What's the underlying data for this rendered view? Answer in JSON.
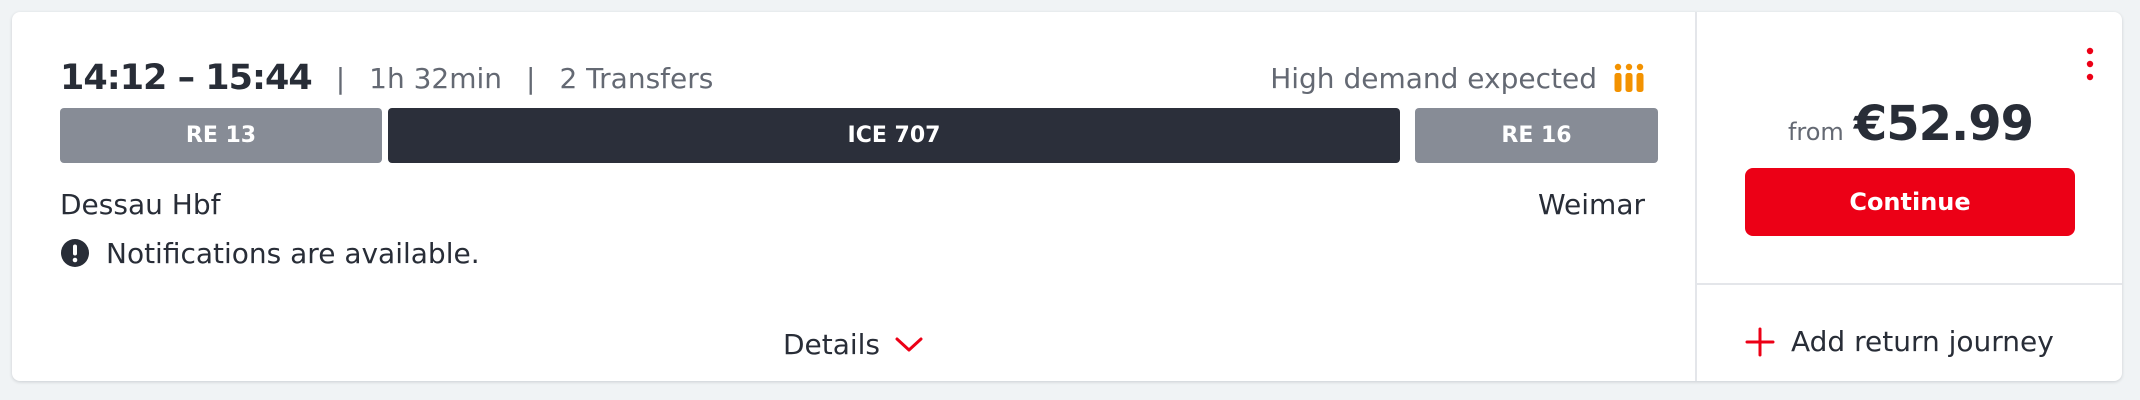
{
  "journey": {
    "time_range": "14:12 – 15:44",
    "separator": "|",
    "duration": "1h 32min",
    "transfers": "2 Transfers",
    "demand": {
      "label": "High demand expected",
      "icon": "occupancy-icon",
      "color": "#f39200"
    },
    "segments": [
      {
        "label": "RE 13",
        "kind": "regional"
      },
      {
        "label": "ICE 707",
        "kind": "long-distance"
      },
      {
        "label": "RE 16",
        "kind": "regional"
      }
    ],
    "origin": "Dessau Hbf",
    "destination": "Weimar",
    "notice": {
      "icon": "exclamation-circle-icon",
      "text": "Notifications are available."
    },
    "details": {
      "label": "Details",
      "icon": "chevron-down-icon"
    }
  },
  "offer": {
    "menu_icon": "kebab-menu-icon",
    "price_prefix": "from",
    "price": "€52.99",
    "continue_label": "Continue",
    "add_return": {
      "icon": "plus-icon",
      "label": "Add return journey"
    }
  },
  "colors": {
    "accent": "#ec0016",
    "regional_segment": "#878c96",
    "long_distance_segment": "#2b2f3a",
    "demand": "#f39200",
    "text": "#282d37",
    "muted_text": "#646973"
  }
}
